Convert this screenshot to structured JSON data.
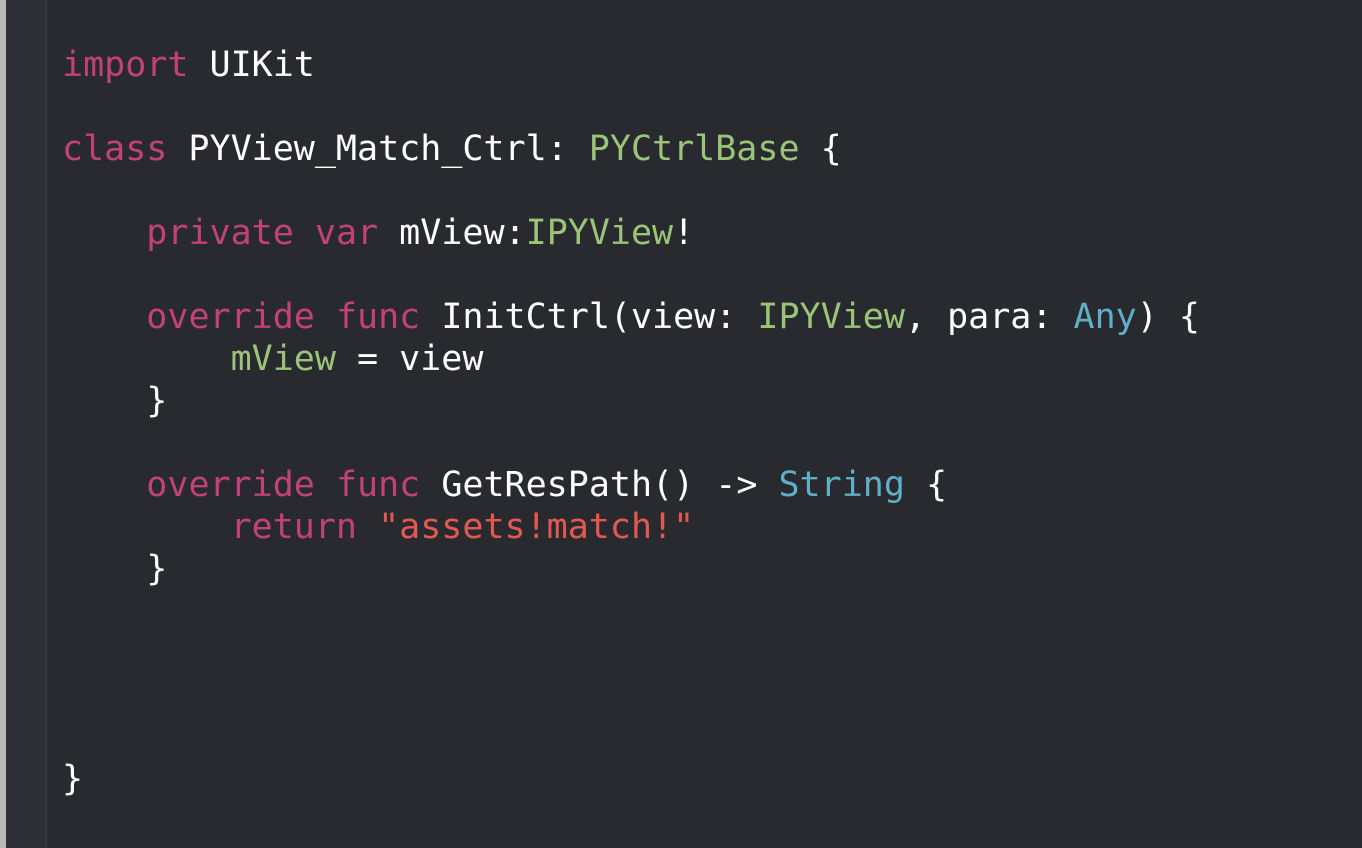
{
  "editor": {
    "lines": [
      {
        "segments": [
          {
            "text": "import",
            "kind": "kw"
          },
          {
            "text": " UIKit",
            "kind": "plain"
          }
        ]
      },
      {
        "segments": []
      },
      {
        "segments": [
          {
            "text": "class",
            "kind": "kw"
          },
          {
            "text": " PYView_Match_Ctrl: ",
            "kind": "plain"
          },
          {
            "text": "PYCtrlBase",
            "kind": "ty"
          },
          {
            "text": " {",
            "kind": "plain"
          }
        ]
      },
      {
        "segments": []
      },
      {
        "segments": [
          {
            "text": "    ",
            "kind": "plain"
          },
          {
            "text": "private",
            "kind": "kw"
          },
          {
            "text": " ",
            "kind": "plain"
          },
          {
            "text": "var",
            "kind": "kw"
          },
          {
            "text": " mView:",
            "kind": "plain"
          },
          {
            "text": "IPYView",
            "kind": "ty"
          },
          {
            "text": "!",
            "kind": "plain"
          }
        ]
      },
      {
        "segments": []
      },
      {
        "segments": [
          {
            "text": "    ",
            "kind": "plain"
          },
          {
            "text": "override",
            "kind": "kw"
          },
          {
            "text": " ",
            "kind": "plain"
          },
          {
            "text": "func",
            "kind": "kw"
          },
          {
            "text": " InitCtrl(view: ",
            "kind": "plain"
          },
          {
            "text": "IPYView",
            "kind": "ty"
          },
          {
            "text": ", para: ",
            "kind": "plain"
          },
          {
            "text": "Any",
            "kind": "sy"
          },
          {
            "text": ") {",
            "kind": "plain"
          }
        ]
      },
      {
        "segments": [
          {
            "text": "        ",
            "kind": "plain"
          },
          {
            "text": "mView",
            "kind": "ty"
          },
          {
            "text": " = view",
            "kind": "plain"
          }
        ]
      },
      {
        "segments": [
          {
            "text": "    }",
            "kind": "plain"
          }
        ]
      },
      {
        "segments": []
      },
      {
        "segments": [
          {
            "text": "    ",
            "kind": "plain"
          },
          {
            "text": "override",
            "kind": "kw"
          },
          {
            "text": " ",
            "kind": "plain"
          },
          {
            "text": "func",
            "kind": "kw"
          },
          {
            "text": " GetResPath() -> ",
            "kind": "plain"
          },
          {
            "text": "String",
            "kind": "sy"
          },
          {
            "text": " {",
            "kind": "plain"
          }
        ]
      },
      {
        "segments": [
          {
            "text": "        ",
            "kind": "plain"
          },
          {
            "text": "return",
            "kind": "kw"
          },
          {
            "text": " ",
            "kind": "plain"
          },
          {
            "text": "\"assets!match!\"",
            "kind": "str"
          }
        ]
      },
      {
        "segments": [
          {
            "text": "    }",
            "kind": "plain"
          }
        ]
      },
      {
        "segments": []
      },
      {
        "segments": []
      },
      {
        "segments": []
      },
      {
        "segments": []
      },
      {
        "segments": [
          {
            "text": "}",
            "kind": "plain"
          }
        ]
      }
    ]
  },
  "colors": {
    "background": "#292a30",
    "keyword": "#c1417a",
    "type": "#9ac477",
    "system_type": "#5fb0c6",
    "string": "#e25a4f",
    "plain": "#ffffff"
  }
}
